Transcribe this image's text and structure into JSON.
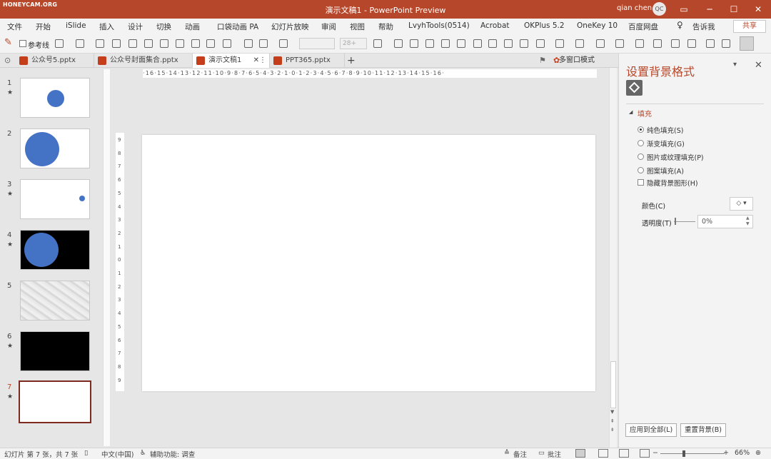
{
  "app": {
    "watermark": "HONEYCAM.ORG",
    "title": "演示文稿1  -  PowerPoint Preview",
    "user_name": "qian chen",
    "user_initials": "QC",
    "window_controls": [
      "ribbon-display-icon",
      "minimize-icon",
      "maximize-icon",
      "close-icon"
    ]
  },
  "menu": {
    "items": [
      "文件",
      "开始",
      "iSlide",
      "插入",
      "设计",
      "切换",
      "动画",
      "口袋动画 PA",
      "幻灯片放映",
      "审阅",
      "视图",
      "帮助",
      "LvyhTools(0514)",
      "Acrobat",
      "OKPlus 5.2",
      "OneKey 10",
      "百度网盘"
    ],
    "tell_me": "告诉我",
    "share": "共享"
  },
  "toolbar": {
    "reference_line": "参考线",
    "font_size": "28+"
  },
  "tabs": {
    "items": [
      "公众号5.pptx",
      "公众号封面集合.pptx",
      "演示文稿1",
      "PPT365.pptx"
    ],
    "active_index": 2,
    "add": "+",
    "multi_window": "多窗口模式"
  },
  "thumbnails": [
    {
      "number": "1",
      "star": "★"
    },
    {
      "number": "2",
      "star": ""
    },
    {
      "number": "3",
      "star": "★"
    },
    {
      "number": "4",
      "star": "★"
    },
    {
      "number": "5",
      "star": ""
    },
    {
      "number": "6",
      "star": "★"
    },
    {
      "number": "7",
      "star": "★"
    }
  ],
  "ruler": {
    "horizontal": "·16·15·14·13·12·11·10·9·8·7·6·5·4·3·2·1·0·1·2·3·4·5·6·7·8·9·10·11·12·13·14·15·16·",
    "vertical": [
      "9",
      "8",
      "7",
      "6",
      "5",
      "4",
      "3",
      "2",
      "1",
      "0",
      "1",
      "2",
      "3",
      "4",
      "5",
      "6",
      "7",
      "8",
      "9"
    ]
  },
  "format_pane": {
    "title": "设置背景格式",
    "dropdown": "▾",
    "close": "✕",
    "fill_section": "填充",
    "fill_options": [
      "纯色填充(S)",
      "渐变填充(G)",
      "图片或纹理填充(P)",
      "图案填充(A)"
    ],
    "selected_option": 0,
    "hide_background": "隐藏背景图形(H)",
    "color_label": "颜色(C)",
    "transparency_label": "透明度(T)",
    "transparency_value": "0%",
    "apply_all": "应用到全部(L)",
    "reset": "重置背景(B)"
  },
  "status": {
    "slide_info": "幻灯片 第 7 张，共 7 张",
    "language": "中文(中国)",
    "accessibility": "辅助功能: 调查",
    "notes": "备注",
    "comments": "批注",
    "zoom": "66%"
  },
  "colors": {
    "accent": "#b7472a",
    "circle": "#4472c4",
    "selected_thumb_border": "#7d2b20"
  }
}
